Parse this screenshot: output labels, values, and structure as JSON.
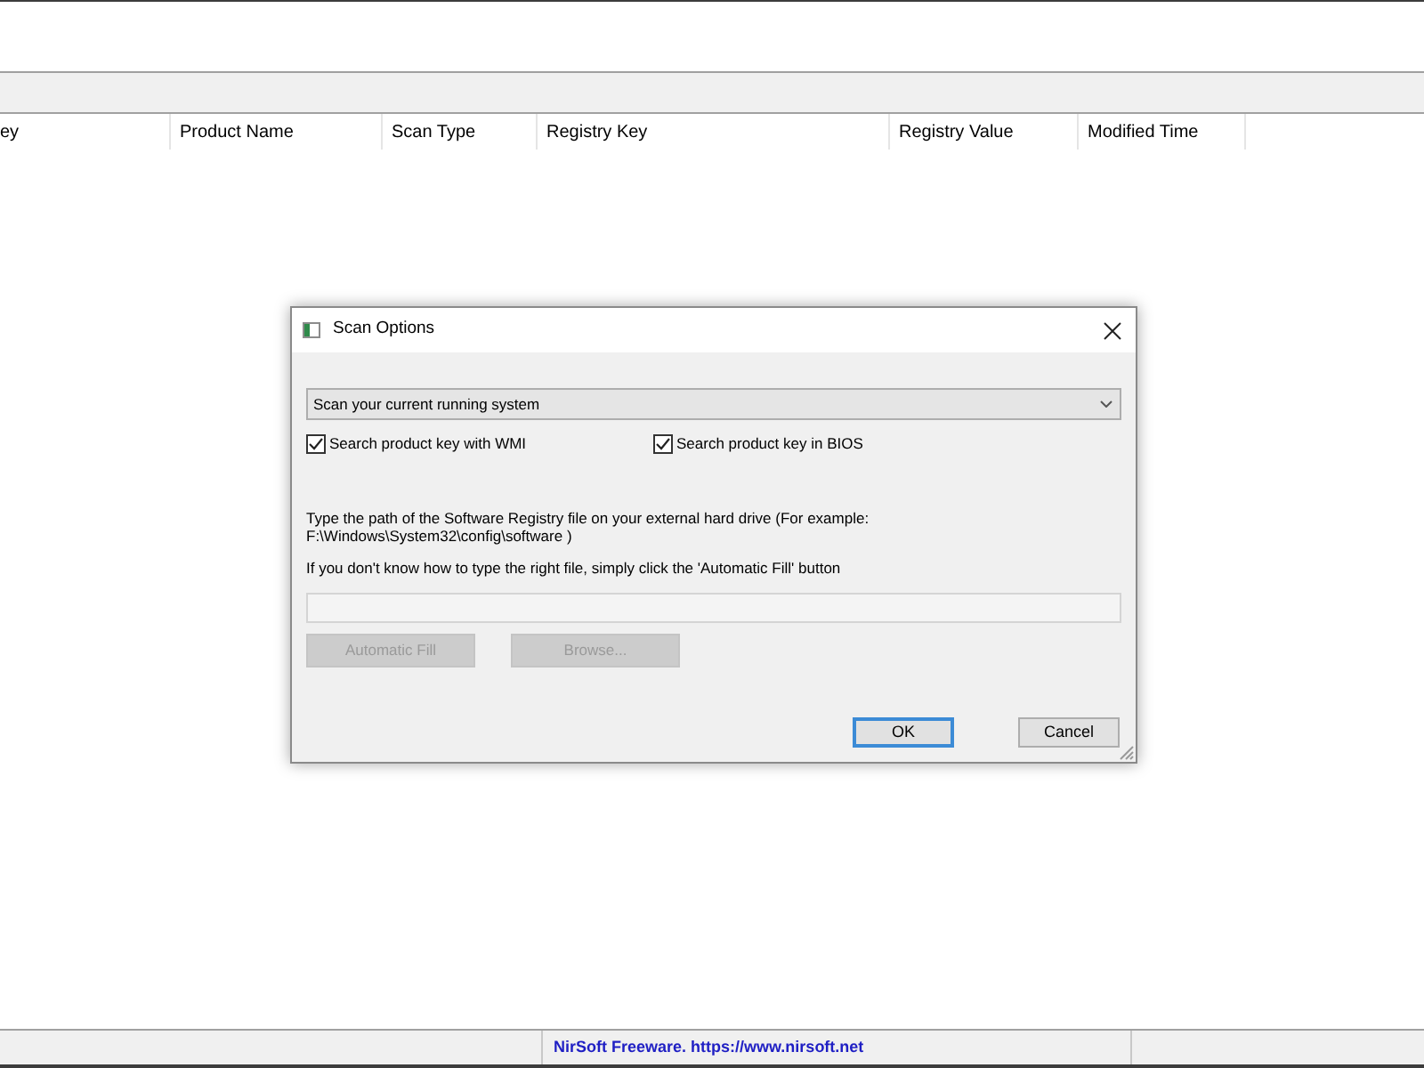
{
  "main_window": {
    "columns": [
      "ey",
      "Product Name",
      "Scan Type",
      "Registry Key",
      "Registry Value",
      "Modified Time"
    ]
  },
  "dialog": {
    "title": "Scan Options",
    "scan_mode": {
      "value": "Scan your current running system"
    },
    "checkboxes": [
      {
        "label": "Search product key with WMI",
        "checked": true
      },
      {
        "label": "Search product key in BIOS",
        "checked": true
      }
    ],
    "path_hint": "Type the path of the Software Registry file on your external hard drive (For example:\nF:\\Windows\\System32\\config\\software )",
    "fill_hint": "If you don't know how to type the right file, simply click the 'Automatic Fill' button",
    "path_field": {
      "disabled": true
    },
    "path_buttons": [
      {
        "label": "Automatic Fill",
        "disabled": true
      },
      {
        "label": "Browse...",
        "disabled": true
      }
    ],
    "buttons": [
      {
        "label": "OK",
        "default": true
      },
      {
        "label": "Cancel",
        "default": false
      }
    ]
  },
  "status_bar": {
    "text": "NirSoft Freeware. https://www.nirsoft.net"
  }
}
